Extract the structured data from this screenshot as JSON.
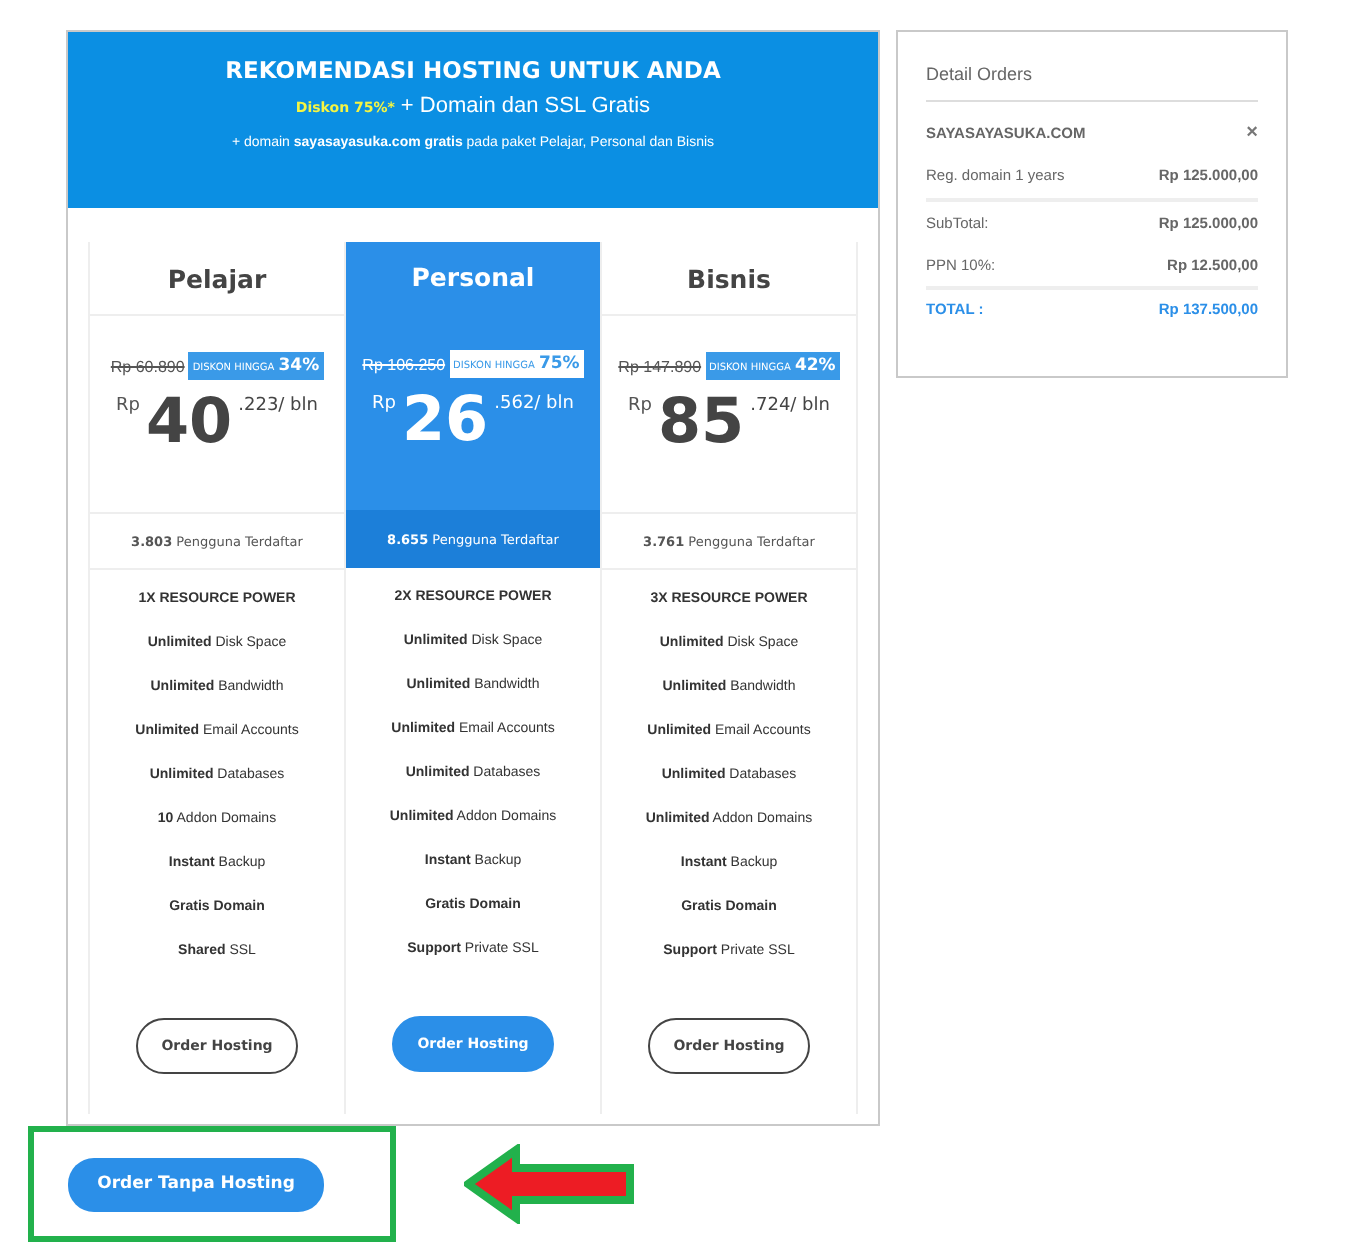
{
  "banner": {
    "title": "REKOMENDASI HOSTING UNTUK ANDA",
    "promo": "Diskon 75%*",
    "subtitle": "+ Domain dan SSL Gratis",
    "note": "+ domain **sayasayasuka.com gratis** pada paket Pelajar, Personal dan Bisnis"
  },
  "plans": [
    {
      "name": "Pelajar",
      "selected": false,
      "old_price": "Rp 60.890",
      "badge_label": "DISKON HINGGA",
      "badge_percent": "34%",
      "currency": "Rp",
      "price_main": "40",
      "price_suffix": ".223/ bln",
      "users": "**3.803** Pengguna Terdaftar",
      "power": "1X RESOURCE POWER",
      "features": [
        {
          "kind": "mixed",
          "text": "**Unlimited** Disk Space"
        },
        {
          "kind": "mixed",
          "text": "**Unlimited** Bandwidth"
        },
        {
          "kind": "mixed",
          "text": "**Unlimited** Email Accounts"
        },
        {
          "kind": "mixed",
          "text": "**Unlimited** Databases"
        },
        {
          "kind": "mixed",
          "text": "**10** Addon Domains"
        },
        {
          "kind": "mixed",
          "text": "**Instant** Backup"
        },
        {
          "kind": "bold",
          "text": "Gratis Domain"
        },
        {
          "kind": "mixed",
          "text": "**Shared** SSL"
        }
      ],
      "button": "Order Hosting"
    },
    {
      "name": "Personal",
      "selected": true,
      "old_price": "Rp 106.250",
      "badge_label": "DISKON HINGGA",
      "badge_percent": "75%",
      "currency": "Rp",
      "price_main": "26",
      "price_suffix": ".562/ bln",
      "users": "**8.655** Pengguna Terdaftar",
      "power": "2X RESOURCE POWER",
      "features": [
        {
          "kind": "mixed",
          "text": "**Unlimited** Disk Space"
        },
        {
          "kind": "mixed",
          "text": "**Unlimited** Bandwidth"
        },
        {
          "kind": "mixed",
          "text": "**Unlimited** Email Accounts"
        },
        {
          "kind": "mixed",
          "text": "**Unlimited** Databases"
        },
        {
          "kind": "mixed",
          "text": "**Unlimited** Addon Domains"
        },
        {
          "kind": "mixed",
          "text": "**Instant** Backup"
        },
        {
          "kind": "bold",
          "text": "Gratis Domain"
        },
        {
          "kind": "mixed",
          "text": "**Support** Private SSL"
        }
      ],
      "button": "Order Hosting"
    },
    {
      "name": "Bisnis",
      "selected": false,
      "old_price": "Rp 147.890",
      "badge_label": "DISKON HINGGA",
      "badge_percent": "42%",
      "currency": "Rp",
      "price_main": "85",
      "price_suffix": ".724/ bln",
      "users": "**3.761** Pengguna Terdaftar",
      "power": "3X RESOURCE POWER",
      "features": [
        {
          "kind": "mixed",
          "text": "**Unlimited** Disk Space"
        },
        {
          "kind": "mixed",
          "text": "**Unlimited** Bandwidth"
        },
        {
          "kind": "mixed",
          "text": "**Unlimited** Email Accounts"
        },
        {
          "kind": "mixed",
          "text": "**Unlimited** Databases"
        },
        {
          "kind": "mixed",
          "text": "**Unlimited** Addon Domains"
        },
        {
          "kind": "mixed",
          "text": "**Instant** Backup"
        },
        {
          "kind": "bold",
          "text": "Gratis Domain"
        },
        {
          "kind": "mixed",
          "text": "**Support** Private SSL"
        }
      ],
      "button": "Order Hosting"
    }
  ],
  "order_button": "Order Tanpa Hosting",
  "detail": {
    "title": "Detail Orders",
    "domain": "SAYASAYASUKA.COM",
    "remove": "×",
    "lines": [
      {
        "kind": "item",
        "label": "Reg. domain 1 years",
        "value": "Rp 125.000,00"
      },
      {
        "kind": "sub",
        "label": "SubTotal:",
        "value": "Rp 125.000,00"
      },
      {
        "kind": "sub",
        "label": "PPN 10%:",
        "value": "Rp 12.500,00"
      },
      {
        "kind": "total",
        "label": "TOTAL :",
        "value": "Rp 137.500,00"
      }
    ]
  }
}
